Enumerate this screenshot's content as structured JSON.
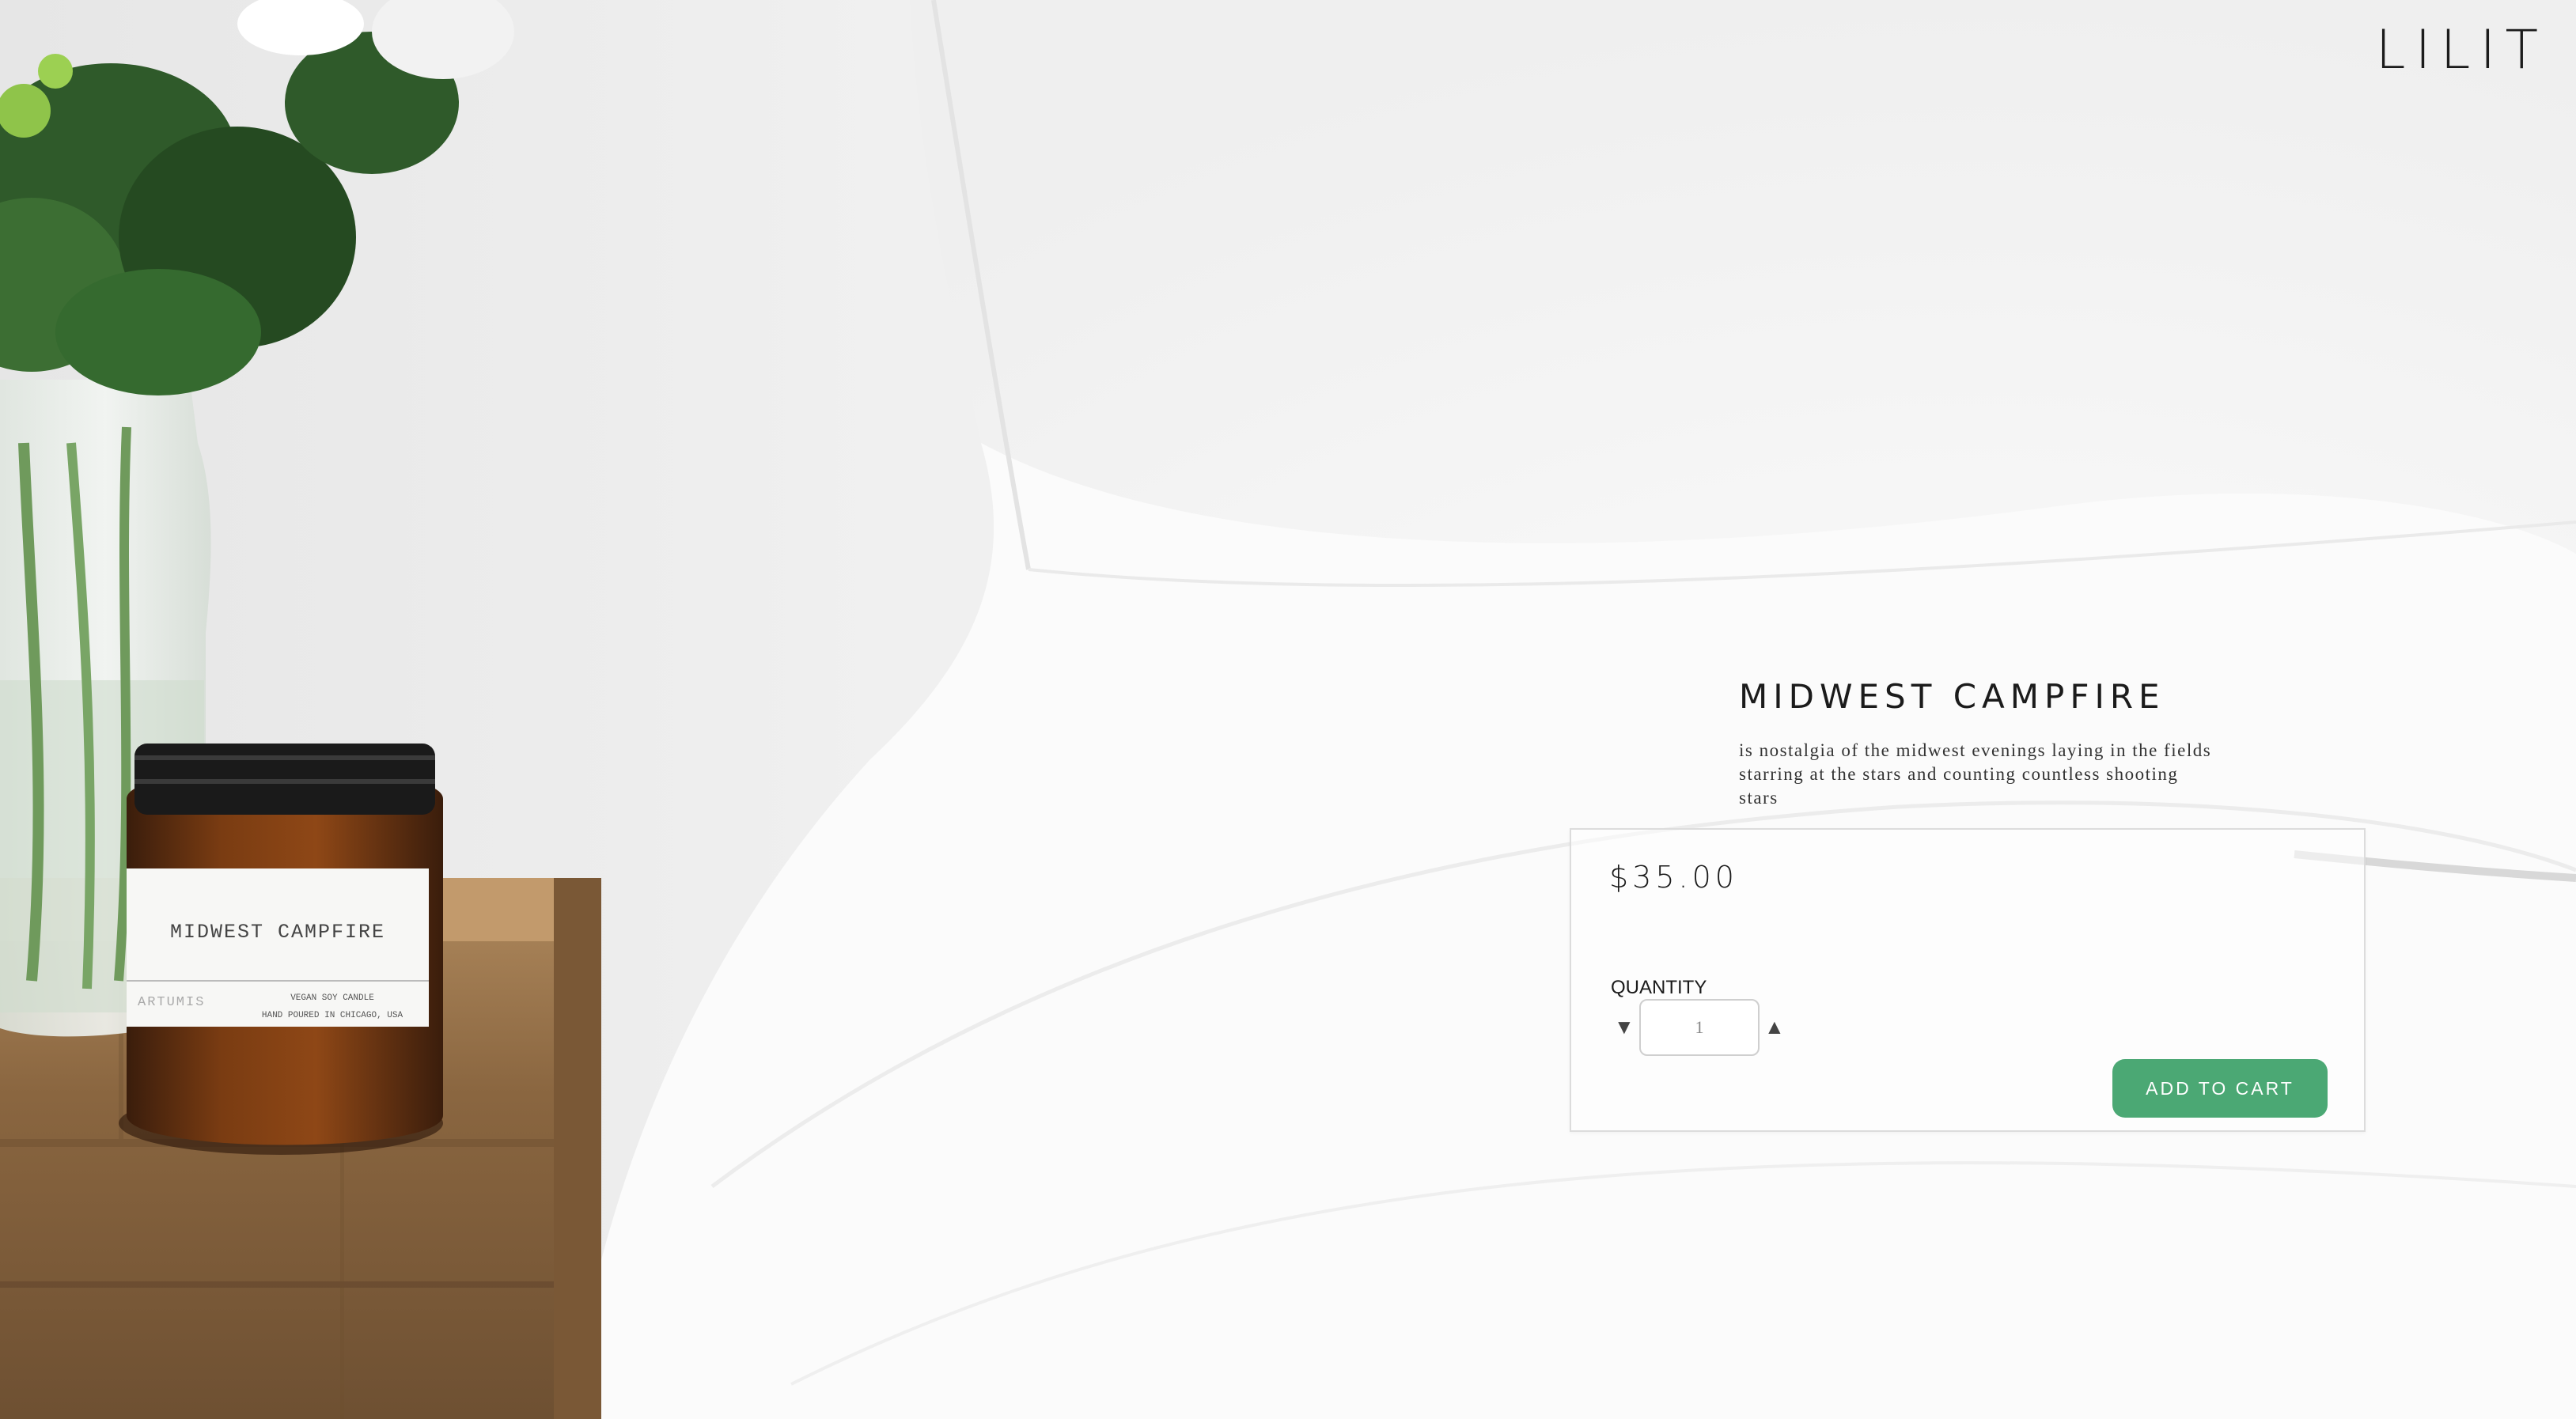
{
  "brand": {
    "name": "LILIT"
  },
  "product": {
    "title": "MIDWEST CAMPFIRE",
    "description": "is nostalgia of the midwest evenings laying in the fields starring at the stars and counting countless shooting stars",
    "price": "$35.00"
  },
  "purchase": {
    "quantity_label": "QUANTITY",
    "quantity_value": "1",
    "decrease_icon": "triangle-down-icon",
    "increase_icon": "triangle-up-icon",
    "add_to_cart_label": "ADD TO CART"
  },
  "candle_label": {
    "name": "MIDWEST CAMPFIRE",
    "brand": "ARTUMIS",
    "line1": "VEGAN SOY CANDLE",
    "line2": "HAND POURED IN CHICAGO, USA"
  },
  "colors": {
    "accent_button": "#4ba874",
    "text": "#1b1b1b",
    "background": "#f4f4f4"
  }
}
